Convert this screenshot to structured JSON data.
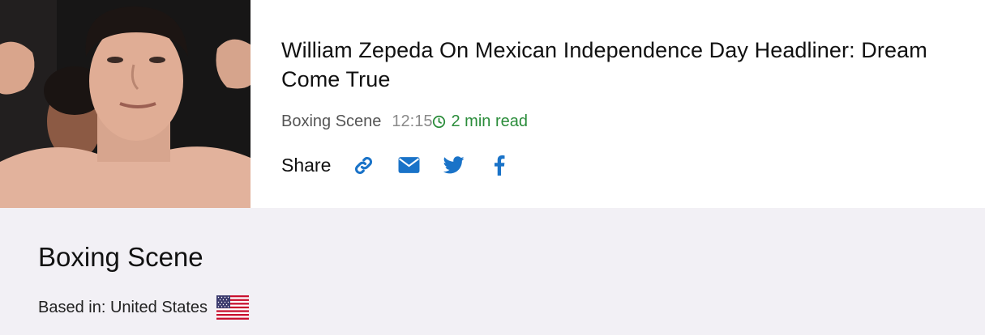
{
  "article": {
    "headline": "William Zepeda On Mexican Independence Day Headliner: Dream Come True",
    "source": "Boxing Scene",
    "time": "12:15",
    "read_time": "2 min read",
    "share_label": "Share",
    "share_icons": [
      "link-icon",
      "envelope-icon",
      "twitter-icon",
      "facebook-icon"
    ],
    "accent_color": "#1a73c8",
    "read_time_color": "#2a8c3a"
  },
  "source_panel": {
    "title": "Boxing Scene",
    "based_in": "Based in: United States",
    "flag_icon": "us-flag-icon",
    "background": "#f2f0f5"
  }
}
